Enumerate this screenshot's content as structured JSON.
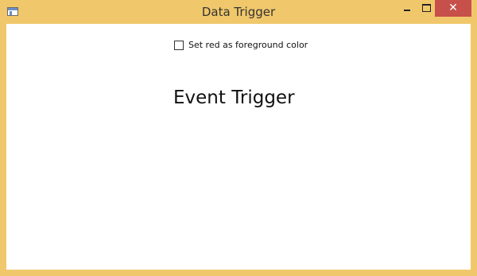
{
  "window": {
    "title": "Data Trigger",
    "close_glyph": "✕",
    "icons": {
      "app": "app-window-icon",
      "minimize": "minimize-icon",
      "maximize": "maximize-icon",
      "close": "close-icon"
    },
    "colors": {
      "frame": "#f0c86b",
      "close_button": "#c7504a",
      "client": "#ffffff"
    }
  },
  "content": {
    "checkbox_label": "Set red as foreground color",
    "checkbox_checked": false,
    "event_trigger_text": "Event Trigger"
  }
}
